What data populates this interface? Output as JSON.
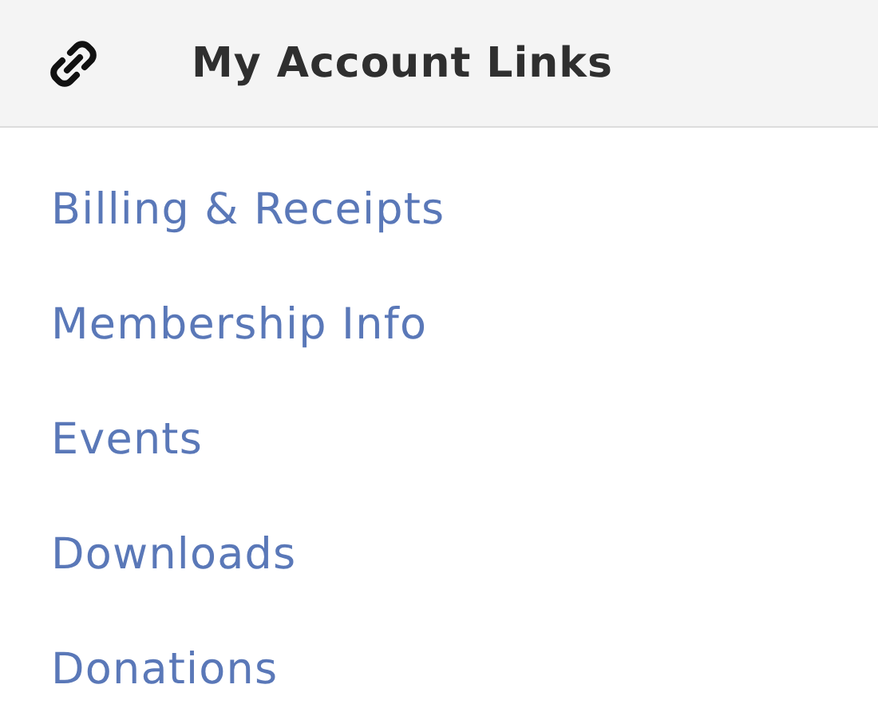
{
  "header": {
    "title": "My Account Links"
  },
  "links": [
    {
      "label": "Billing & Receipts"
    },
    {
      "label": "Membership Info"
    },
    {
      "label": "Events"
    },
    {
      "label": "Downloads"
    },
    {
      "label": "Donations"
    }
  ]
}
